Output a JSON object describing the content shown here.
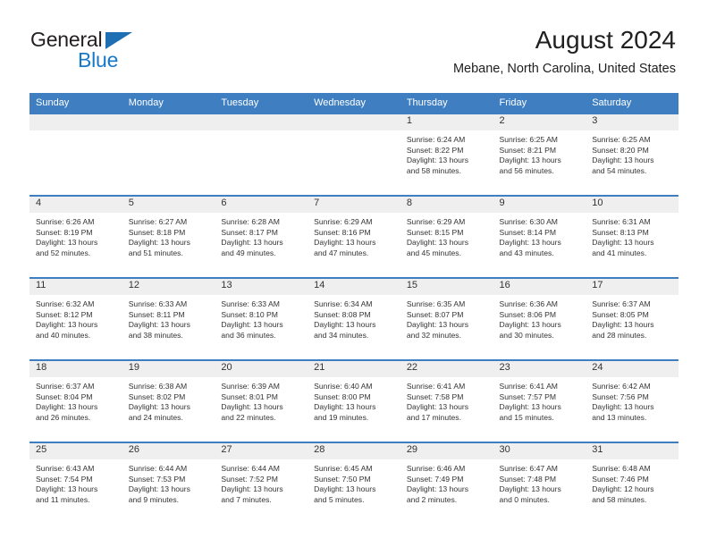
{
  "brand": {
    "line1": "General",
    "line2": "Blue",
    "triangle_color": "#1f6fb5",
    "text_color": "#231f20",
    "blue_color": "#1878c8"
  },
  "header": {
    "title": "August 2024",
    "subtitle": "Mebane, North Carolina, United States"
  },
  "theme": {
    "header_bar": "#3f7fc1",
    "cell_head_bg": "#efefef",
    "text": "#333333"
  },
  "weekdays": [
    "Sunday",
    "Monday",
    "Tuesday",
    "Wednesday",
    "Thursday",
    "Friday",
    "Saturday"
  ],
  "weeks": [
    [
      {
        "day": "",
        "sunrise": "",
        "sunset": "",
        "daylight": "",
        "daylight2": ""
      },
      {
        "day": "",
        "sunrise": "",
        "sunset": "",
        "daylight": "",
        "daylight2": ""
      },
      {
        "day": "",
        "sunrise": "",
        "sunset": "",
        "daylight": "",
        "daylight2": ""
      },
      {
        "day": "",
        "sunrise": "",
        "sunset": "",
        "daylight": "",
        "daylight2": ""
      },
      {
        "day": "1",
        "sunrise": "Sunrise: 6:24 AM",
        "sunset": "Sunset: 8:22 PM",
        "daylight": "Daylight: 13 hours",
        "daylight2": "and 58 minutes."
      },
      {
        "day": "2",
        "sunrise": "Sunrise: 6:25 AM",
        "sunset": "Sunset: 8:21 PM",
        "daylight": "Daylight: 13 hours",
        "daylight2": "and 56 minutes."
      },
      {
        "day": "3",
        "sunrise": "Sunrise: 6:25 AM",
        "sunset": "Sunset: 8:20 PM",
        "daylight": "Daylight: 13 hours",
        "daylight2": "and 54 minutes."
      }
    ],
    [
      {
        "day": "4",
        "sunrise": "Sunrise: 6:26 AM",
        "sunset": "Sunset: 8:19 PM",
        "daylight": "Daylight: 13 hours",
        "daylight2": "and 52 minutes."
      },
      {
        "day": "5",
        "sunrise": "Sunrise: 6:27 AM",
        "sunset": "Sunset: 8:18 PM",
        "daylight": "Daylight: 13 hours",
        "daylight2": "and 51 minutes."
      },
      {
        "day": "6",
        "sunrise": "Sunrise: 6:28 AM",
        "sunset": "Sunset: 8:17 PM",
        "daylight": "Daylight: 13 hours",
        "daylight2": "and 49 minutes."
      },
      {
        "day": "7",
        "sunrise": "Sunrise: 6:29 AM",
        "sunset": "Sunset: 8:16 PM",
        "daylight": "Daylight: 13 hours",
        "daylight2": "and 47 minutes."
      },
      {
        "day": "8",
        "sunrise": "Sunrise: 6:29 AM",
        "sunset": "Sunset: 8:15 PM",
        "daylight": "Daylight: 13 hours",
        "daylight2": "and 45 minutes."
      },
      {
        "day": "9",
        "sunrise": "Sunrise: 6:30 AM",
        "sunset": "Sunset: 8:14 PM",
        "daylight": "Daylight: 13 hours",
        "daylight2": "and 43 minutes."
      },
      {
        "day": "10",
        "sunrise": "Sunrise: 6:31 AM",
        "sunset": "Sunset: 8:13 PM",
        "daylight": "Daylight: 13 hours",
        "daylight2": "and 41 minutes."
      }
    ],
    [
      {
        "day": "11",
        "sunrise": "Sunrise: 6:32 AM",
        "sunset": "Sunset: 8:12 PM",
        "daylight": "Daylight: 13 hours",
        "daylight2": "and 40 minutes."
      },
      {
        "day": "12",
        "sunrise": "Sunrise: 6:33 AM",
        "sunset": "Sunset: 8:11 PM",
        "daylight": "Daylight: 13 hours",
        "daylight2": "and 38 minutes."
      },
      {
        "day": "13",
        "sunrise": "Sunrise: 6:33 AM",
        "sunset": "Sunset: 8:10 PM",
        "daylight": "Daylight: 13 hours",
        "daylight2": "and 36 minutes."
      },
      {
        "day": "14",
        "sunrise": "Sunrise: 6:34 AM",
        "sunset": "Sunset: 8:08 PM",
        "daylight": "Daylight: 13 hours",
        "daylight2": "and 34 minutes."
      },
      {
        "day": "15",
        "sunrise": "Sunrise: 6:35 AM",
        "sunset": "Sunset: 8:07 PM",
        "daylight": "Daylight: 13 hours",
        "daylight2": "and 32 minutes."
      },
      {
        "day": "16",
        "sunrise": "Sunrise: 6:36 AM",
        "sunset": "Sunset: 8:06 PM",
        "daylight": "Daylight: 13 hours",
        "daylight2": "and 30 minutes."
      },
      {
        "day": "17",
        "sunrise": "Sunrise: 6:37 AM",
        "sunset": "Sunset: 8:05 PM",
        "daylight": "Daylight: 13 hours",
        "daylight2": "and 28 minutes."
      }
    ],
    [
      {
        "day": "18",
        "sunrise": "Sunrise: 6:37 AM",
        "sunset": "Sunset: 8:04 PM",
        "daylight": "Daylight: 13 hours",
        "daylight2": "and 26 minutes."
      },
      {
        "day": "19",
        "sunrise": "Sunrise: 6:38 AM",
        "sunset": "Sunset: 8:02 PM",
        "daylight": "Daylight: 13 hours",
        "daylight2": "and 24 minutes."
      },
      {
        "day": "20",
        "sunrise": "Sunrise: 6:39 AM",
        "sunset": "Sunset: 8:01 PM",
        "daylight": "Daylight: 13 hours",
        "daylight2": "and 22 minutes."
      },
      {
        "day": "21",
        "sunrise": "Sunrise: 6:40 AM",
        "sunset": "Sunset: 8:00 PM",
        "daylight": "Daylight: 13 hours",
        "daylight2": "and 19 minutes."
      },
      {
        "day": "22",
        "sunrise": "Sunrise: 6:41 AM",
        "sunset": "Sunset: 7:58 PM",
        "daylight": "Daylight: 13 hours",
        "daylight2": "and 17 minutes."
      },
      {
        "day": "23",
        "sunrise": "Sunrise: 6:41 AM",
        "sunset": "Sunset: 7:57 PM",
        "daylight": "Daylight: 13 hours",
        "daylight2": "and 15 minutes."
      },
      {
        "day": "24",
        "sunrise": "Sunrise: 6:42 AM",
        "sunset": "Sunset: 7:56 PM",
        "daylight": "Daylight: 13 hours",
        "daylight2": "and 13 minutes."
      }
    ],
    [
      {
        "day": "25",
        "sunrise": "Sunrise: 6:43 AM",
        "sunset": "Sunset: 7:54 PM",
        "daylight": "Daylight: 13 hours",
        "daylight2": "and 11 minutes."
      },
      {
        "day": "26",
        "sunrise": "Sunrise: 6:44 AM",
        "sunset": "Sunset: 7:53 PM",
        "daylight": "Daylight: 13 hours",
        "daylight2": "and 9 minutes."
      },
      {
        "day": "27",
        "sunrise": "Sunrise: 6:44 AM",
        "sunset": "Sunset: 7:52 PM",
        "daylight": "Daylight: 13 hours",
        "daylight2": "and 7 minutes."
      },
      {
        "day": "28",
        "sunrise": "Sunrise: 6:45 AM",
        "sunset": "Sunset: 7:50 PM",
        "daylight": "Daylight: 13 hours",
        "daylight2": "and 5 minutes."
      },
      {
        "day": "29",
        "sunrise": "Sunrise: 6:46 AM",
        "sunset": "Sunset: 7:49 PM",
        "daylight": "Daylight: 13 hours",
        "daylight2": "and 2 minutes."
      },
      {
        "day": "30",
        "sunrise": "Sunrise: 6:47 AM",
        "sunset": "Sunset: 7:48 PM",
        "daylight": "Daylight: 13 hours",
        "daylight2": "and 0 minutes."
      },
      {
        "day": "31",
        "sunrise": "Sunrise: 6:48 AM",
        "sunset": "Sunset: 7:46 PM",
        "daylight": "Daylight: 12 hours",
        "daylight2": "and 58 minutes."
      }
    ]
  ]
}
